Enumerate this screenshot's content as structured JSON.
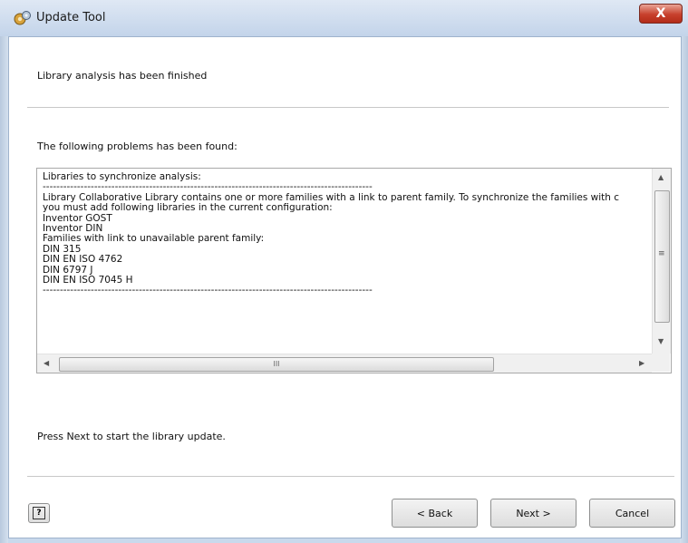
{
  "window": {
    "title": "Update Tool",
    "close_label": "X"
  },
  "status_message": "Library analysis has been finished",
  "problems_heading": "The following problems has been found:",
  "problems_text": [
    "Libraries to synchronize analysis:",
    "------------------------------------------------------------------------------------------------",
    "Library Collaborative Library contains one or more families with a link to parent family. To synchronize the families with c",
    "you must add following libraries in the current configuration:",
    "Inventor GOST",
    "Inventor DIN",
    "Families with link to unavailable parent family:",
    "DIN 315",
    "DIN EN ISO 4762",
    "DIN 6797 J",
    "DIN EN ISO 7045 H",
    "------------------------------------------------------------------------------------------------"
  ],
  "scroll": {
    "h_thumb_grip": "III",
    "up_arrow": "▲",
    "down_arrow": "▼",
    "left_arrow": "◀",
    "right_arrow": "▶",
    "v_thumb_grip": "≡"
  },
  "footer_message": "Press Next to start the library update.",
  "buttons": {
    "help": "?",
    "back": "< Back",
    "next": "Next >",
    "cancel": "Cancel"
  }
}
